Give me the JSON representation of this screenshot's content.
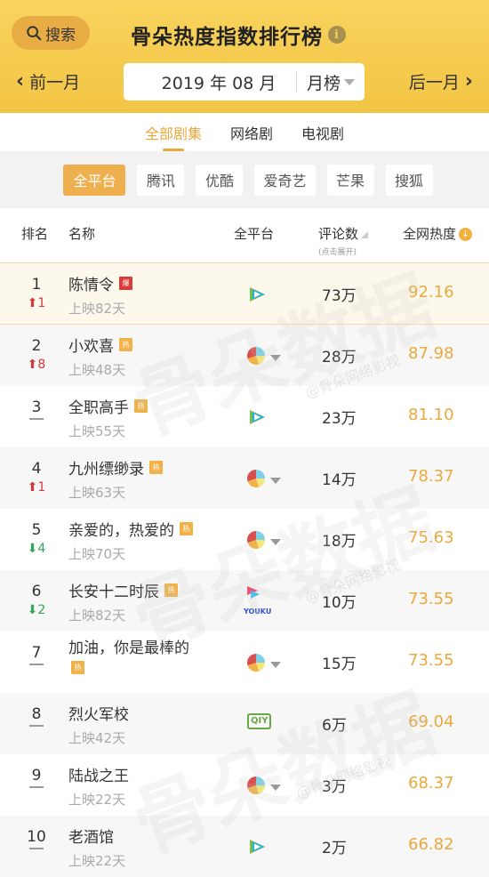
{
  "header": {
    "search_label": "搜索",
    "title": "骨朵热度指数排行榜",
    "info_icon": "i",
    "prev_label": "前一月",
    "next_label": "后一月",
    "date": "2019 年 08 月",
    "period": "月榜"
  },
  "tabs": [
    {
      "label": "全部剧集",
      "active": true
    },
    {
      "label": "网络剧",
      "active": false
    },
    {
      "label": "电视剧",
      "active": false
    }
  ],
  "platforms": [
    {
      "label": "全平台",
      "active": true
    },
    {
      "label": "腾讯",
      "active": false
    },
    {
      "label": "优酷",
      "active": false
    },
    {
      "label": "爱奇艺",
      "active": false
    },
    {
      "label": "芒果",
      "active": false
    },
    {
      "label": "搜狐",
      "active": false
    }
  ],
  "table_header": {
    "rank": "排名",
    "name": "名称",
    "platform": "全平台",
    "comments": "评论数",
    "comments_hint": "(点击展开)",
    "heat": "全网热度"
  },
  "rows": [
    {
      "rank": "1",
      "change": "1",
      "change_dir": "up",
      "name": "陈情令",
      "badge": "爆",
      "badge_type": "bao",
      "days": "上映82天",
      "platform": "tencent",
      "comments": "73万",
      "heat": "92.16"
    },
    {
      "rank": "2",
      "change": "8",
      "change_dir": "up",
      "name": "小欢喜",
      "badge": "热",
      "badge_type": "re",
      "days": "上映48天",
      "platform": "multi",
      "comments": "28万",
      "heat": "87.98"
    },
    {
      "rank": "3",
      "change": "",
      "change_dir": "same",
      "name": "全职高手",
      "badge": "热",
      "badge_type": "re",
      "days": "上映55天",
      "platform": "tencent",
      "comments": "23万",
      "heat": "81.10"
    },
    {
      "rank": "4",
      "change": "1",
      "change_dir": "up",
      "name": "九州缥缈录",
      "badge": "热",
      "badge_type": "re",
      "days": "上映63天",
      "platform": "multi",
      "comments": "14万",
      "heat": "78.37"
    },
    {
      "rank": "5",
      "change": "4",
      "change_dir": "down",
      "name": "亲爱的，热爱的",
      "badge": "热",
      "badge_type": "re",
      "days": "上映70天",
      "platform": "multi",
      "comments": "18万",
      "heat": "75.63"
    },
    {
      "rank": "6",
      "change": "2",
      "change_dir": "down",
      "name": "长安十二时辰",
      "badge": "热",
      "badge_type": "re",
      "days": "上映82天",
      "platform": "youku",
      "comments": "10万",
      "heat": "73.55"
    },
    {
      "rank": "7",
      "change": "",
      "change_dir": "same",
      "name": "加油，你是最棒的",
      "badge": "热",
      "badge_type": "re",
      "days": "",
      "platform": "multi",
      "comments": "15万",
      "heat": "73.55"
    },
    {
      "rank": "8",
      "change": "",
      "change_dir": "same",
      "name": "烈火军校",
      "badge": "",
      "badge_type": "",
      "days": "上映42天",
      "platform": "iqiyi",
      "comments": "6万",
      "heat": "69.04"
    },
    {
      "rank": "9",
      "change": "",
      "change_dir": "same",
      "name": "陆战之王",
      "badge": "",
      "badge_type": "",
      "days": "上映22天",
      "platform": "multi",
      "comments": "3万",
      "heat": "68.37"
    },
    {
      "rank": "10",
      "change": "",
      "change_dir": "same",
      "name": "老酒馆",
      "badge": "",
      "badge_type": "",
      "days": "上映22天",
      "platform": "tencent",
      "comments": "2万",
      "heat": "66.82"
    }
  ],
  "platform_labels": {
    "youku": "YOUKU",
    "iqiyi": "QIY"
  },
  "watermark": {
    "main": "骨朵数据",
    "sub": "@骨朵网络影视"
  },
  "colors": {
    "accent": "#e8a83c",
    "header_bg": "#f6cd50",
    "up": "#d03a3a",
    "down": "#35a35a"
  }
}
